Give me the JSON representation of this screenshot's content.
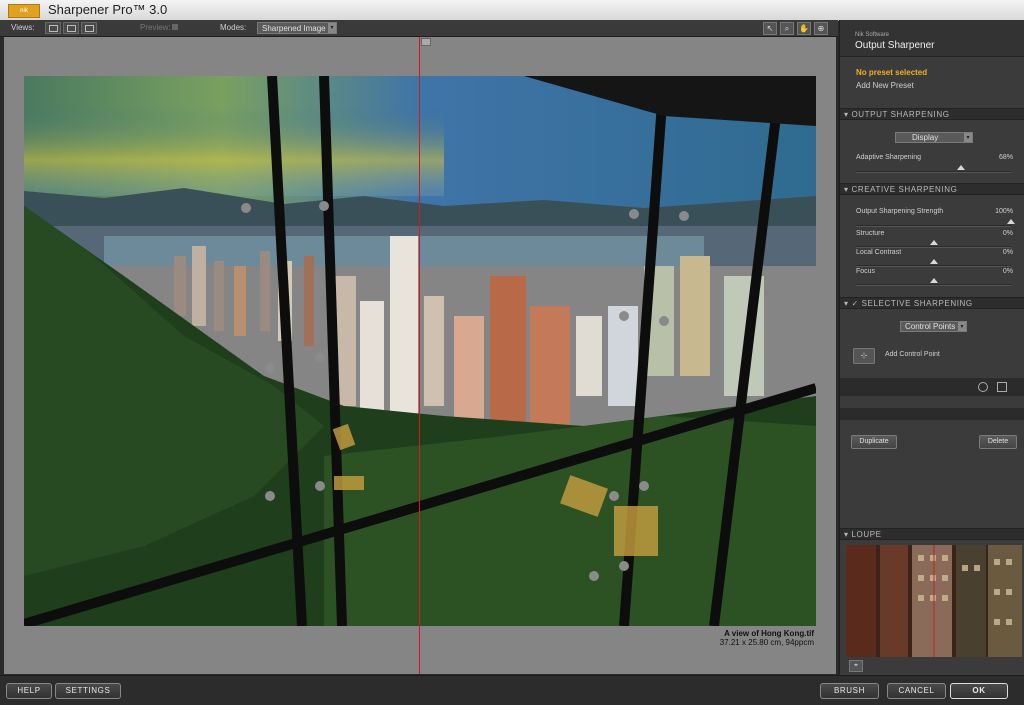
{
  "app": {
    "logo_text": "nik",
    "title": "Sharpener Pro™ 3.0"
  },
  "toolbar": {
    "views_label": "Views:",
    "preview_label": "Preview:",
    "modes_label": "Modes:",
    "mode_value": "Sharpened Image"
  },
  "image": {
    "name": "A view of Hong Kong.tif",
    "size_info": "37.21 x 25.80 cm, 94ppcm"
  },
  "panel": {
    "vendor": "Nik Software",
    "product": "Output Sharpener",
    "preset_status": "No preset selected",
    "add_preset": "Add New Preset",
    "output_sharpening": {
      "header": "OUTPUT SHARPENING",
      "dropdown": "Display",
      "adaptive_label": "Adaptive Sharpening",
      "adaptive_value": "68%",
      "adaptive_level": 68
    },
    "creative_sharpening": {
      "header": "CREATIVE SHARPENING",
      "rows": [
        {
          "label": "Output Sharpening Strength",
          "value": "100%",
          "level": 100
        },
        {
          "label": "Structure",
          "value": "0%",
          "level": 0
        },
        {
          "label": "Local Contrast",
          "value": "0%",
          "level": 0
        },
        {
          "label": "Focus",
          "value": "0%",
          "level": 0
        }
      ]
    },
    "selective_sharpening": {
      "header": "SELECTIVE SHARPENING",
      "checked": "✓",
      "dropdown": "Control Points",
      "add_control_point": "Add Control Point",
      "duplicate": "Duplicate",
      "delete": "Delete"
    },
    "loupe_header": "LOUPE"
  },
  "buttons": {
    "help": "HELP",
    "settings": "SETTINGS",
    "brush": "BRUSH",
    "cancel": "CANCEL",
    "ok": "OK"
  },
  "icons": [
    "single-view-icon",
    "split-view-icon",
    "side-by-side-view-icon",
    "preview-toggle-icon",
    "dropdown-arrow-icon",
    "pointer-tool-icon",
    "zoom-tool-icon",
    "hand-tool-icon",
    "pin-tool-icon",
    "control-point-icon",
    "loupe-pin-icon"
  ]
}
